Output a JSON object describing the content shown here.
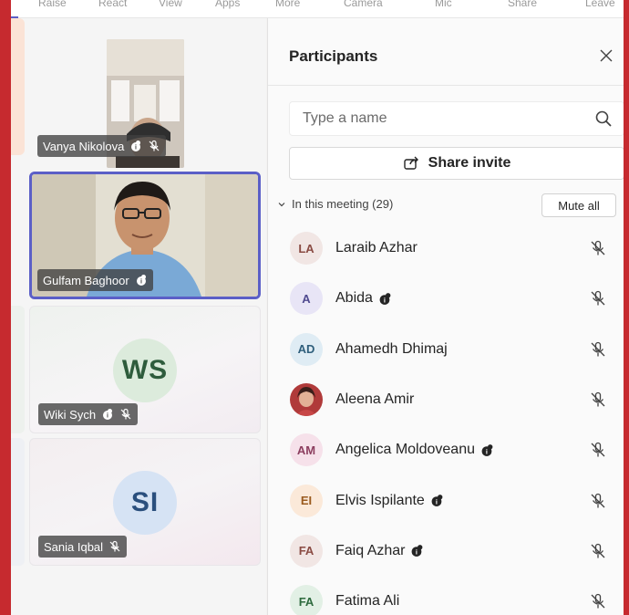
{
  "toolbar": {
    "items": [
      "Raise",
      "React",
      "View",
      "Apps",
      "More",
      "Camera",
      "Mic",
      "Share",
      "Leave"
    ]
  },
  "stage": {
    "tiles": [
      {
        "name": "Vanya Nikolova",
        "type": "video"
      },
      {
        "name": "Gulfam Baghoor",
        "type": "video",
        "active": true
      },
      {
        "name": "Wiki Sych",
        "initials": "WS",
        "type": "initials"
      },
      {
        "name": "Sania Iqbal",
        "initials": "SI",
        "type": "initials"
      }
    ]
  },
  "panel": {
    "title": "Participants",
    "search_placeholder": "Type a name",
    "share_label": "Share invite",
    "section_label": "In this meeting (29)",
    "mute_all_label": "Mute all",
    "participants": [
      {
        "initials": "LA",
        "name": "Laraib Azhar",
        "org_icon": false,
        "avatar_bg": "#f1e6e4",
        "avatar_fg": "#8a4b43"
      },
      {
        "initials": "A",
        "name": "Abida",
        "org_icon": true,
        "avatar_bg": "#e8e5f6",
        "avatar_fg": "#4f4a8f"
      },
      {
        "initials": "AD",
        "name": "Ahamedh Dhimaj",
        "org_icon": false,
        "avatar_bg": "#dfecf4",
        "avatar_fg": "#2f5f7c"
      },
      {
        "initials": "",
        "name": "Aleena Amir",
        "org_icon": false,
        "photo": true
      },
      {
        "initials": "AM",
        "name": "Angelica Moldoveanu",
        "org_icon": true,
        "avatar_bg": "#f6e1ea",
        "avatar_fg": "#8c3e5f"
      },
      {
        "initials": "EI",
        "name": "Elvis Ispilante",
        "org_icon": true,
        "avatar_bg": "#fbe9d9",
        "avatar_fg": "#9a5a1e"
      },
      {
        "initials": "FA",
        "name": "Faiq Azhar",
        "org_icon": true,
        "avatar_bg": "#f1e6e4",
        "avatar_fg": "#8a4b43"
      },
      {
        "initials": "FA",
        "name": "Fatima Ali",
        "org_icon": false,
        "avatar_bg": "#e2f0e5",
        "avatar_fg": "#2e6b3e"
      }
    ]
  },
  "colors": {
    "frame": "#c62a2f",
    "accent": "#5b5fc7"
  }
}
